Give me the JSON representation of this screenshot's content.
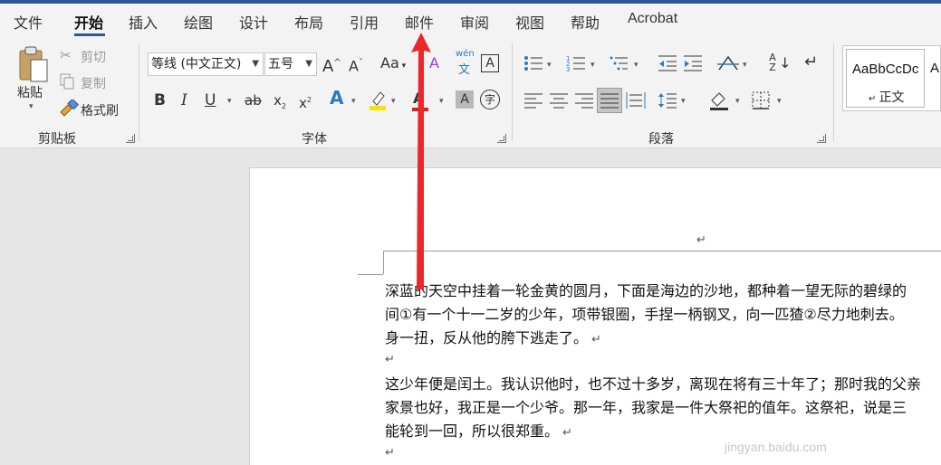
{
  "tabs": [
    "文件",
    "开始",
    "插入",
    "绘图",
    "设计",
    "布局",
    "引用",
    "邮件",
    "审阅",
    "视图",
    "帮助",
    "Acrobat"
  ],
  "active_tab": "开始",
  "clipboard": {
    "paste": "粘贴",
    "cut": "剪切",
    "copy": "复制",
    "format_painter": "格式刷",
    "group": "剪贴板"
  },
  "font": {
    "name": "等线 (中文正文)",
    "size": "五号",
    "grow": "A",
    "shrink": "A",
    "change_case": "Aa",
    "phonetic": "wén",
    "phonetic_char": "文",
    "bold": "B",
    "italic": "I",
    "underline": "U",
    "strike": "ab",
    "subscript": "x",
    "superscript": "x",
    "effects": "A",
    "shading": "A",
    "enclose": "字",
    "border": "A",
    "group": "字体"
  },
  "paragraph": {
    "group": "段落",
    "sort": "A Z"
  },
  "styles": {
    "sample": "AaBbCcDc",
    "name": "正文",
    "sample2": "A"
  },
  "document": {
    "return_mark": "↵",
    "lines": [
      "深蓝的天空中挂着一轮金黄的圆月，下面是海边的沙地，都种着一望无际的碧绿的",
      "间①有一个十一二岁的少年，项带银圈，手捏一柄钢叉，向一匹猹②尽力地刺去。",
      "身一扭，反从他的胯下逃走了。",
      "",
      "这少年便是闰土。我认识他时，也不过十多岁，离现在将有三十年了；那时我的父亲",
      "家景也好，我正是一个少爷。那一年，我家是一件大祭祀的值年。这祭祀，说是三",
      "能轮到一回，所以很郑重。",
      ""
    ]
  },
  "watermark": "jingyan.baidu.com",
  "colors": {
    "accent": "#2b579a",
    "arrow": "#e8282a",
    "highlight": "#f5e400",
    "font_color": "#d42020"
  }
}
